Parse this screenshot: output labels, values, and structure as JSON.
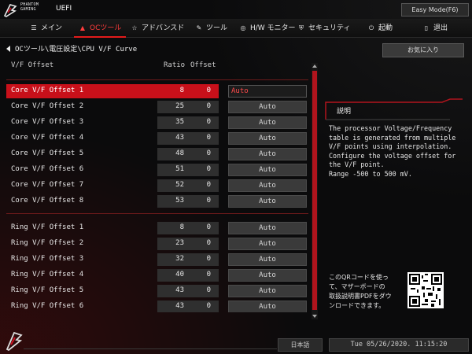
{
  "app": {
    "brand_line1": "PHANTOM",
    "brand_line2": "GAMING",
    "product": "UEFI",
    "mode_button": "Easy Mode(F6)"
  },
  "tabs": [
    {
      "icon": "menu-icon",
      "label": "メイン",
      "active": false
    },
    {
      "icon": "flame-icon",
      "label": "OCツール",
      "active": true
    },
    {
      "icon": "star-icon",
      "label": "アドバンスド",
      "active": false
    },
    {
      "icon": "tool-icon",
      "label": "ツール",
      "active": false
    },
    {
      "icon": "monitor-icon",
      "label": "H/W モニター",
      "active": false
    },
    {
      "icon": "shield-icon",
      "label": "セキュリティ",
      "active": false
    },
    {
      "icon": "power-icon",
      "label": "起動",
      "active": false
    },
    {
      "icon": "exit-icon",
      "label": "退出",
      "active": false
    }
  ],
  "breadcrumb": "OCツール\\電圧設定\\CPU V/F Curve",
  "favorites_button": "お気に入り",
  "columns": {
    "name": "V/F Offset",
    "ratio": "Ratio",
    "offset": "Offset"
  },
  "core_rows": [
    {
      "label": "Core V/F Offset 1",
      "ratio": "8",
      "offset": "0",
      "value": "Auto",
      "selected": true
    },
    {
      "label": "Core V/F Offset 2",
      "ratio": "25",
      "offset": "0",
      "value": "Auto"
    },
    {
      "label": "Core V/F Offset 3",
      "ratio": "35",
      "offset": "0",
      "value": "Auto"
    },
    {
      "label": "Core V/F Offset 4",
      "ratio": "43",
      "offset": "0",
      "value": "Auto"
    },
    {
      "label": "Core V/F Offset 5",
      "ratio": "48",
      "offset": "0",
      "value": "Auto"
    },
    {
      "label": "Core V/F Offset 6",
      "ratio": "51",
      "offset": "0",
      "value": "Auto"
    },
    {
      "label": "Core V/F Offset 7",
      "ratio": "52",
      "offset": "0",
      "value": "Auto"
    },
    {
      "label": "Core V/F Offset 8",
      "ratio": "53",
      "offset": "0",
      "value": "Auto"
    }
  ],
  "ring_rows": [
    {
      "label": "Ring V/F Offset 1",
      "ratio": "8",
      "offset": "0",
      "value": "Auto"
    },
    {
      "label": "Ring V/F Offset 2",
      "ratio": "23",
      "offset": "0",
      "value": "Auto"
    },
    {
      "label": "Ring V/F Offset 3",
      "ratio": "32",
      "offset": "0",
      "value": "Auto"
    },
    {
      "label": "Ring V/F Offset 4",
      "ratio": "40",
      "offset": "0",
      "value": "Auto"
    },
    {
      "label": "Ring V/F Offset 5",
      "ratio": "43",
      "offset": "0",
      "value": "Auto"
    },
    {
      "label": "Ring V/F Offset 6",
      "ratio": "43",
      "offset": "0",
      "value": "Auto"
    }
  ],
  "help": {
    "title": "説明",
    "text": "The processor Voltage/Frequency\ntable is generated from multiple\nV/F points using interpolation.\nConfigure the voltage offset for\nthe V/F point.\nRange -500 to 500 mV.",
    "qr_text": "このQRコードを使っ\nて、マザーボードの\n取扱説明書PDFをダウ\nンロードできます。"
  },
  "footer": {
    "language": "日本語",
    "datetime": "Tue 05/26/2020. 11:15:20"
  },
  "colors": {
    "accent": "#c8101a",
    "active_tab": "#ff3c3c",
    "background": "#0b0b0c"
  }
}
